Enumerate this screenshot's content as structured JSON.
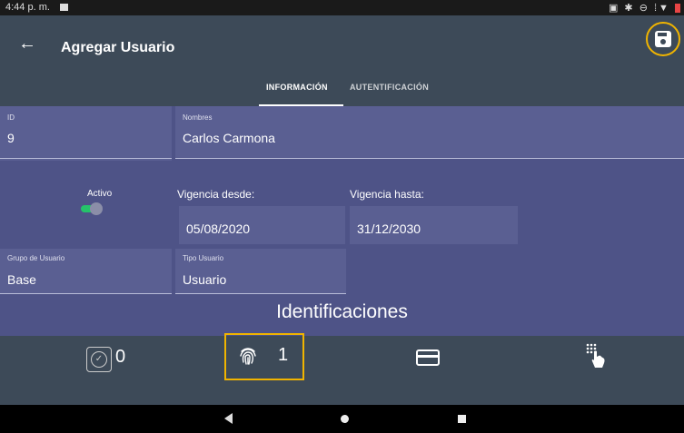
{
  "status_bar": {
    "time": "4:44 p. m.",
    "system_icons": "▣ ✱ ⊖ ⁞▼"
  },
  "app_bar": {
    "title": "Agregar Usuario",
    "back_icon": "arrow-left-icon",
    "save_icon": "save-icon"
  },
  "tabs": [
    {
      "label": "INFORMACIÓN",
      "selected": true
    },
    {
      "label": "AUTENTIFICACIÓN",
      "selected": false
    }
  ],
  "form": {
    "id": {
      "label": "ID",
      "value": "9"
    },
    "nombres": {
      "label": "Nombres",
      "value": "Carlos Carmona"
    },
    "activo": {
      "label": "Activo",
      "value": true
    },
    "vigencia_desde": {
      "label": "Vigencia desde:",
      "value": "05/08/2020"
    },
    "vigencia_hasta": {
      "label": "Vigencia hasta:",
      "value": "31/12/2030"
    },
    "grupo_usuario": {
      "label": "Grupo de Usuario",
      "value": "Base"
    },
    "tipo_usuario": {
      "label": "Tipo Usuario",
      "value": "Usuario"
    }
  },
  "identificaciones": {
    "title": "Identificaciones",
    "items": [
      {
        "icon": "face-recognition-icon",
        "count": "0"
      },
      {
        "icon": "fingerprint-icon",
        "count": "1",
        "highlighted": true
      },
      {
        "icon": "card-icon",
        "count": ""
      },
      {
        "icon": "keypad-touch-icon",
        "count": ""
      }
    ]
  },
  "colors": {
    "appbar": "#3d4a58",
    "form_bg": "#4e5387",
    "highlight": "#f0b400",
    "toggle_on": "#25c26a"
  }
}
